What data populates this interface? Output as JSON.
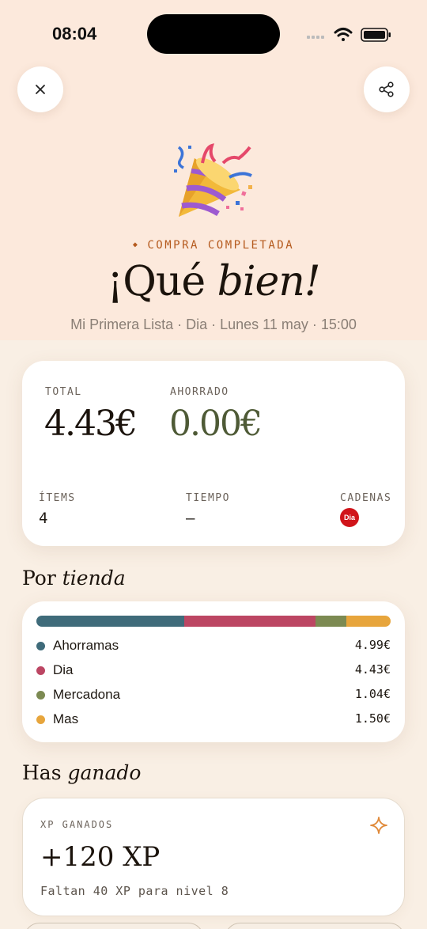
{
  "status": {
    "time": "08:04"
  },
  "header": {
    "close_icon": "close-icon",
    "share_icon": "share-icon",
    "celebration_icon": "party-popper-icon",
    "eyebrow": "COMPRA COMPLETADA",
    "headline_pre": "¡Qué ",
    "headline_em": "bien!",
    "subline": "Mi Primera Lista · Dia · Lunes 11 may · 15:00"
  },
  "summary": {
    "total_label": "TOTAL",
    "total_value": "4.43€",
    "saved_label": "AHORRADO",
    "saved_value": "0.00€",
    "items_label": "ÍTEMS",
    "items_value": "4",
    "time_label": "TIEMPO",
    "time_value": "–",
    "chains_label": "CADENAS",
    "chain_logo_text": "Dia"
  },
  "by_store": {
    "title_pre": "Por ",
    "title_em": "tienda",
    "stores": [
      {
        "name": "Ahorramas",
        "value": "4.99€",
        "amount": 4.99,
        "color": "#3f6b7a"
      },
      {
        "name": "Dia",
        "value": "4.43€",
        "amount": 4.43,
        "color": "#bc4663"
      },
      {
        "name": "Mercadona",
        "value": "1.04€",
        "amount": 1.04,
        "color": "#7c8a52"
      },
      {
        "name": "Mas",
        "value": "1.50€",
        "amount": 1.5,
        "color": "#e7a53c"
      }
    ]
  },
  "earned": {
    "title_pre": "Has ",
    "title_em": "ganado",
    "xp_label": "XP GANADOS",
    "xp_value": "+120 XP",
    "xp_sub": "Faltan 40 XP para nivel 8",
    "sparkle_icon": "sparkle-icon"
  },
  "colors": {
    "accent_orange": "#b55a1e",
    "saved_green": "#4e5a36",
    "dia_red": "#d0141a"
  }
}
